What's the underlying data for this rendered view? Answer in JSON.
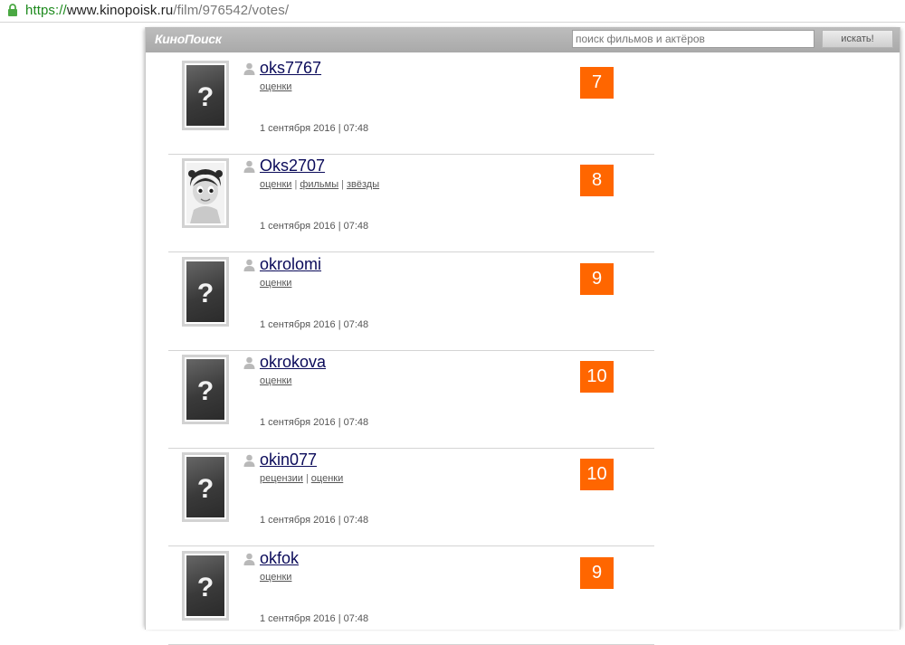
{
  "browser": {
    "url_protocol": "https://",
    "url_host": "www.kinopoisk.ru",
    "url_path": "/film/976542/votes/"
  },
  "header": {
    "logo": "КиноПоиск",
    "search_placeholder": "поиск фильмов и актёров",
    "search_button": "искать!"
  },
  "votes": [
    {
      "user": "oks7767",
      "links": [
        "оценки"
      ],
      "date": "1 сентября 2016 | 07:48",
      "score": "7",
      "avatar": "placeholder"
    },
    {
      "user": "Oks2707",
      "links": [
        "оценки",
        "фильмы",
        "звёзды"
      ],
      "date": "1 сентября 2016 | 07:48",
      "score": "8",
      "avatar": "photo"
    },
    {
      "user": "okrolomi",
      "links": [
        "оценки"
      ],
      "date": "1 сентября 2016 | 07:48",
      "score": "9",
      "avatar": "placeholder"
    },
    {
      "user": "okrokova",
      "links": [
        "оценки"
      ],
      "date": "1 сентября 2016 | 07:48",
      "score": "10",
      "avatar": "placeholder"
    },
    {
      "user": "okin077",
      "links": [
        "рецензии",
        "оценки"
      ],
      "date": "1 сентября 2016 | 07:48",
      "score": "10",
      "avatar": "placeholder"
    },
    {
      "user": "okfok",
      "links": [
        "оценки"
      ],
      "date": "1 сентября 2016 | 07:48",
      "score": "9",
      "avatar": "placeholder"
    }
  ],
  "colors": {
    "score_bg": "#ff6600",
    "username": "#0b0b5a",
    "url_protocol": "#1d8a1d"
  }
}
